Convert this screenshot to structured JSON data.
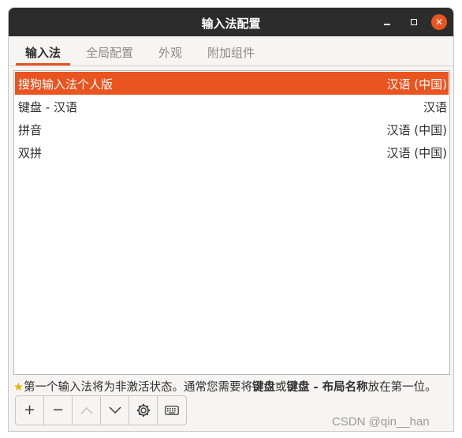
{
  "window": {
    "title": "输入法配置"
  },
  "tabs": [
    {
      "label": "输入法"
    },
    {
      "label": "全局配置"
    },
    {
      "label": "外观"
    },
    {
      "label": "附加组件"
    }
  ],
  "input_methods": [
    {
      "name": "搜狗输入法个人版",
      "language": "汉语 (中国)"
    },
    {
      "name": "键盘 - 汉语",
      "language": "汉语"
    },
    {
      "name": "拼音",
      "language": "汉语 (中国)"
    },
    {
      "name": "双拼",
      "language": "汉语 (中国)"
    }
  ],
  "hint": {
    "star_icon": "★",
    "part1": "第一个输入法将为非激活状态。通常您需要将",
    "bold1": "键盘",
    "part2": "或",
    "bold2": "键盘 - 布局名称",
    "part3": "放在第一位。"
  },
  "toolbar": {
    "add_label": "+",
    "remove_label": "−",
    "up_icon": "chevron-up-icon",
    "down_icon": "chevron-down-icon",
    "configure_icon": "gear-icon",
    "keyboard_icon": "keyboard-icon"
  },
  "watermark": "CSDN @qin__han",
  "colors": {
    "accent": "#e95420",
    "titlebar": "#2c2c2c"
  }
}
